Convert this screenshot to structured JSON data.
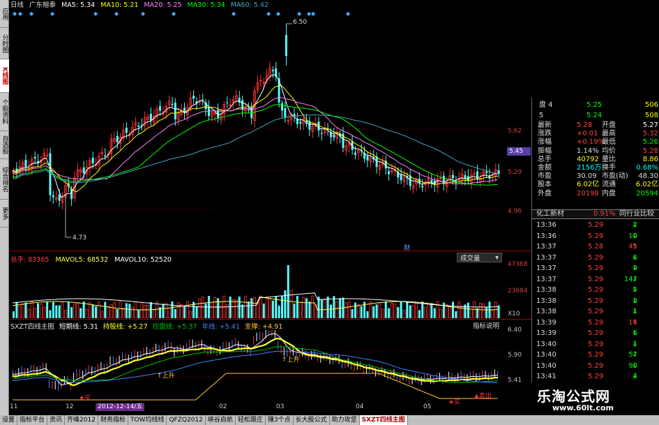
{
  "left_tabs": [
    {
      "label": "应用",
      "active": false
    },
    {
      "label": "分时图",
      "active": false
    },
    {
      "label": "K线图",
      "active": true
    },
    {
      "label": "个股资料",
      "active": false
    },
    {
      "label": "自选股",
      "active": false
    },
    {
      "label": "综合排名",
      "active": false
    },
    {
      "label": "更多",
      "active": false
    }
  ],
  "header": {
    "period": "日线",
    "stock": "广东榕泰",
    "ma5": "MA5: 5.34",
    "ma10": "MA10: 5.21",
    "ma20": "MA20: 5.25",
    "ma30": "MA30: 5.34",
    "ma60": "MA60: 5.42"
  },
  "price_axis": {
    "ticks": [
      "5.62",
      "5.29",
      "4.96"
    ],
    "current": "5.45"
  },
  "annotations": {
    "high": "6.50",
    "low": "4.73",
    "cai": "财"
  },
  "volume": {
    "title": "总手: 83365",
    "mavol5": "MAVOL5: 68532",
    "mavol10": "MAVOL10: 52520",
    "button": "成交量",
    "axis": [
      "47368",
      "23684",
      "X10"
    ]
  },
  "indicator": {
    "name": "SXZT四线主图",
    "short": "短期线: 5.31",
    "hold": "持股线: +5.27",
    "ctrl": "控盘线: +5.37",
    "year": "年线: +5.41",
    "support": "支撑: +4.91",
    "help": "指标说明",
    "axis": [
      "6.40",
      "5.90",
      "5.41"
    ],
    "signals": {
      "buy": "买",
      "rise": "上升",
      "sell": "卖出"
    }
  },
  "x_axis": [
    "11",
    "12",
    "02",
    "03",
    "04",
    "05"
  ],
  "date_tag": "2012-12-14/五",
  "bottom_tabs": [
    "设置",
    "指标平台",
    "资讯",
    "齐峰2012",
    "财务指标",
    "TOW均线线",
    "QFZQ2012",
    "峡谷启航",
    "轻松跟庄",
    "赚3个点",
    "长大股公式",
    "助力攻坚",
    "SXZT四线主图"
  ],
  "quote": {
    "book": [
      {
        "label": "盘 4",
        "price": "5.25",
        "vol": "506"
      },
      {
        "label": "5",
        "price": "5.24",
        "vol": "508"
      }
    ],
    "stats": [
      [
        "最新",
        "5.28",
        "开盘",
        "5.27"
      ],
      [
        "涨跌",
        "+0.01",
        "最高",
        "5.32"
      ],
      [
        "涨幅",
        "+0.19%",
        "最低",
        "5.26"
      ],
      [
        "振幅",
        "1.14%",
        "均价",
        "5.28"
      ],
      [
        "总手",
        "40792",
        "量比",
        "8.86"
      ],
      [
        "金额",
        "2156万",
        "换手",
        "0.68%"
      ],
      [
        "市盈",
        "30.09",
        "市盈(动)",
        "48.30"
      ],
      [
        "股本",
        "6.02亿",
        "流通",
        "6.02亿"
      ],
      [
        "外盘",
        "20198",
        "内盘",
        "20594"
      ]
    ],
    "industry": {
      "name": "化工新材",
      "change": "0.91%",
      "compare": "同行业比较"
    },
    "ticks": [
      [
        "13:36",
        "5.29",
        "2",
        "down"
      ],
      [
        "13:36",
        "5.29",
        "10",
        "down"
      ],
      [
        "13:37",
        "5.28",
        "45",
        "up"
      ],
      [
        "13:37",
        "5.29",
        "6",
        "down"
      ],
      [
        "13:37",
        "5.29",
        "9",
        "down"
      ],
      [
        "13:37",
        "5.29",
        "147",
        "down"
      ],
      [
        "13:38",
        "5.29",
        "5",
        "down"
      ],
      [
        "13:38",
        "5.29",
        "8",
        "down"
      ],
      [
        "13:38",
        "5.29",
        "1",
        "down"
      ],
      [
        "13:39",
        "5.29",
        "14",
        "up"
      ],
      [
        "13:39",
        "5.29",
        "6",
        "down"
      ],
      [
        "13:40",
        "5.29",
        "1",
        "down"
      ],
      [
        "13:40",
        "5.29",
        "57",
        "down"
      ],
      [
        "13:40",
        "5.29",
        "90",
        "down"
      ],
      [
        "13:41",
        "5.29",
        "4",
        "down"
      ]
    ]
  },
  "watermark": {
    "title": "乐淘公式网",
    "url": "www.60lt.com"
  },
  "colors": {
    "up": "#ff3232",
    "down": "#54ffff",
    "ma5": "#ffffff",
    "ma10": "#ffff00",
    "ma20": "#ff80ff",
    "ma30": "#00ff00",
    "ma60": "#3fa9c0"
  }
}
